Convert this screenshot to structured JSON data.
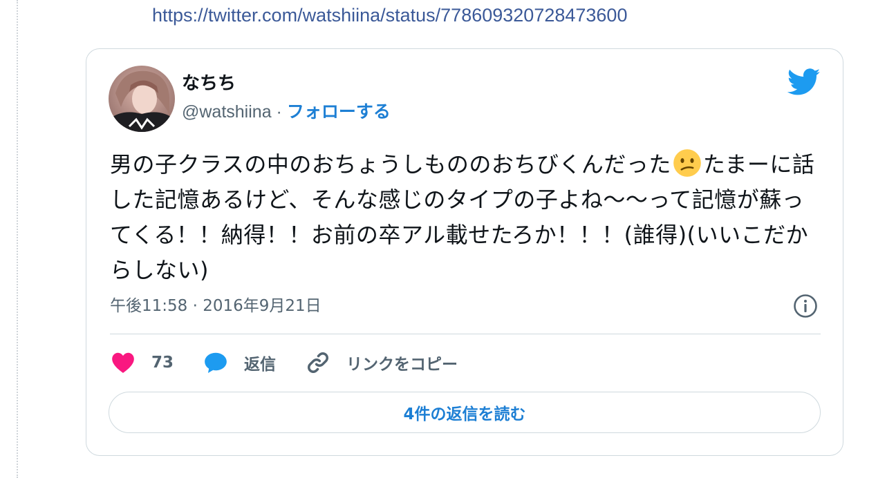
{
  "status_url": "https://twitter.com/watshiina/status/778609320728473600",
  "tweet": {
    "display_name": "なちち",
    "handle": "@watshiina",
    "separator": " · ",
    "follow_label": "フォローする",
    "text_part1": "男の子クラスの中のおちょうしもののおちびくんだった",
    "emoji_name": "confused-face-emoji",
    "text_part2": "たまーに話した記憶あるけど、そんな感じのタイプの子よね〜〜って記憶が蘇ってくる！！納得！！お前の卒アル載せたろか！！！(誰得)(いいこだからしない)",
    "timestamp": "午後11:58 · 2016年9月21日",
    "likes_count": "73",
    "reply_label": "返信",
    "copy_link_label": "リンクをコピー",
    "read_replies_label": "4件の返信を読む"
  },
  "colors": {
    "link": "#3b5998",
    "accent": "#1d7fd4",
    "twitter_blue": "#1d9bf0",
    "heart": "#f91880",
    "muted": "#536471",
    "border": "#cfd9de"
  },
  "icons": [
    "twitter-bird-icon",
    "info-icon",
    "heart-icon",
    "reply-bubble-icon",
    "link-chain-icon"
  ]
}
